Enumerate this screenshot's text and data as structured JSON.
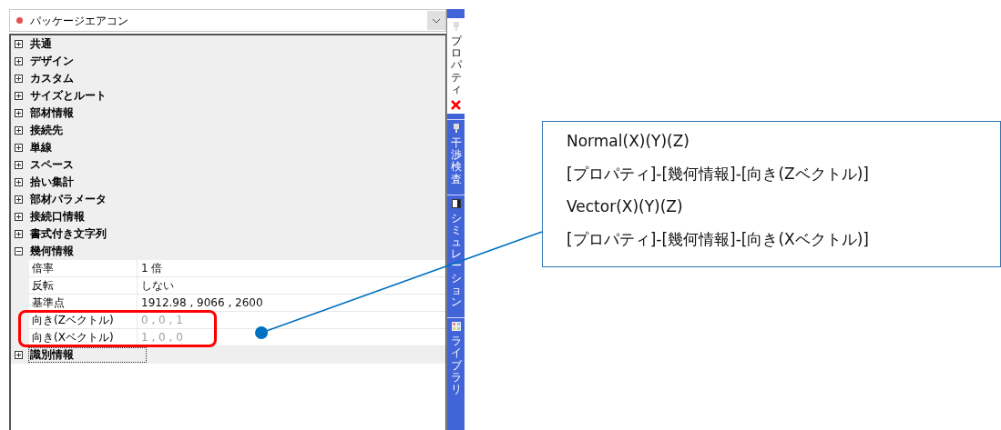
{
  "dropdown": {
    "value": "パッケージエアコン",
    "color": "#e05050"
  },
  "categories": [
    {
      "label": "共通",
      "expanded": false,
      "focused": false
    },
    {
      "label": "デザイン",
      "expanded": false,
      "focused": false
    },
    {
      "label": "カスタム",
      "expanded": false,
      "focused": false
    },
    {
      "label": "サイズとルート",
      "expanded": false,
      "focused": false
    },
    {
      "label": "部材情報",
      "expanded": false,
      "focused": false
    },
    {
      "label": "接続先",
      "expanded": false,
      "focused": false
    },
    {
      "label": "単線",
      "expanded": false,
      "focused": false
    },
    {
      "label": "スペース",
      "expanded": false,
      "focused": false
    },
    {
      "label": "拾い集計",
      "expanded": false,
      "focused": false
    },
    {
      "label": "部材パラメータ",
      "expanded": false,
      "focused": false
    },
    {
      "label": "接続口情報",
      "expanded": false,
      "focused": false
    },
    {
      "label": "書式付き文字列",
      "expanded": false,
      "focused": false
    },
    {
      "label": "幾何情報",
      "expanded": true,
      "focused": false,
      "children": [
        {
          "name": "倍率",
          "value": "1 倍",
          "disabled": false
        },
        {
          "name": "反転",
          "value": "しない",
          "disabled": false
        },
        {
          "name": "基準点",
          "value": "1912.98 , 9066 , 2600",
          "disabled": false
        },
        {
          "name": "向き(Zベクトル)",
          "value": "0 , 0 , 1",
          "disabled": true
        },
        {
          "name": "向き(Xベクトル)",
          "value": "1 , 0 , 0",
          "disabled": true
        }
      ]
    },
    {
      "label": "識別情報",
      "expanded": false,
      "focused": true
    }
  ],
  "side_tabs": [
    {
      "label": "プロパティ",
      "selected": true,
      "kind": "pin"
    },
    {
      "label": "干渉検査",
      "selected": false,
      "kind": "pin"
    },
    {
      "label": "シミュレーション",
      "selected": false,
      "kind": "panel"
    },
    {
      "label": "ライブラリ",
      "selected": false,
      "kind": "grid"
    }
  ],
  "callout": {
    "lines": [
      "Normal(X)(Y)(Z)",
      "[プロパティ]-[幾何情報]-[向き(Zベクトル)]",
      "Vector(X)(Y)(Z)",
      "[プロパティ]-[幾何情報]-[向き(Xベクトル)]"
    ]
  }
}
